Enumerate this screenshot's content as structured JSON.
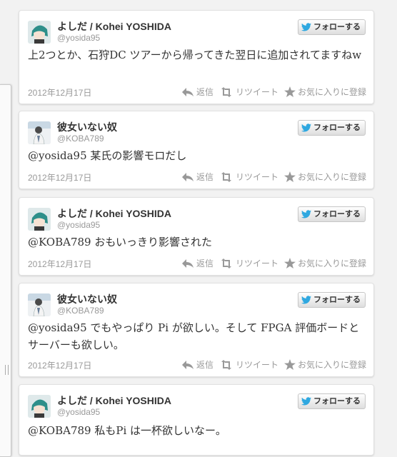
{
  "tweets": [
    {
      "user": "よしだ / Kohei YOSHIDA",
      "handle": "@yosida95",
      "text": "上2つとか、石狩DC ツアーから帰ってきた翌日に追加されてますねw",
      "date": "2012年12月17日",
      "avatar": "anime-avatar"
    },
    {
      "user": "彼女いない奴",
      "handle": "@KOBA789",
      "text": "@yosida95 某氏の影響モロだし",
      "date": "2012年12月17日",
      "avatar": "person-avatar"
    },
    {
      "user": "よしだ / Kohei YOSHIDA",
      "handle": "@yosida95",
      "text": "@KOBA789 おもいっきり影響された",
      "date": "2012年12月17日",
      "avatar": "anime-avatar"
    },
    {
      "user": "彼女いない奴",
      "handle": "@KOBA789",
      "text": "@yosida95 でもやっぱり Pi が欲しい。そして FPGA 評価ボードとサーバーも欲しい。",
      "date": "2012年12月17日",
      "avatar": "person-avatar"
    },
    {
      "user": "よしだ / Kohei YOSHIDA",
      "handle": "@yosida95",
      "text": "@KOBA789 私もPi は一杯欲しいなー。",
      "date": "",
      "avatar": "anime-avatar"
    }
  ],
  "labels": {
    "follow": "フォローする",
    "reply": "返信",
    "retweet": "リツイート",
    "favorite": "お気に入りに登録"
  },
  "colors": {
    "accent": "#2fa8e0",
    "muted": "#999999",
    "text": "#333333"
  }
}
